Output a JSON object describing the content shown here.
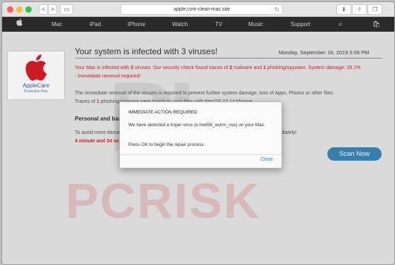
{
  "browser": {
    "url": "apple.com-clean-mac.site",
    "back": "<",
    "forward": ">",
    "reload": "↻"
  },
  "nav": {
    "items": [
      "Mac",
      "iPad",
      "iPhone",
      "Watch",
      "TV",
      "Music",
      "Support"
    ]
  },
  "watermark": {
    "big": "PL",
    "red": "PCRISK"
  },
  "applecare": {
    "title": "AppleCare",
    "subtitle": "Protection Plan"
  },
  "page": {
    "heading": "Your system is infected with 3 viruses!",
    "date": "Monday, September 16, 2019 5:06 PM",
    "alert": {
      "a": "Your Mac is infected with ",
      "n1": "3",
      "b": " viruses. Our security check found traces of ",
      "n2": "2",
      "c": " malware and ",
      "n3": "1",
      "d": " phishing/spyware. System damage: 28.1%",
      "e": "- Immediate removal required!"
    },
    "para1": "The immediate removal of the viruses is required to prevent further system damage, loss of Apps, Photos or other files.",
    "para2_a": "Traces of ",
    "para2_n": "1",
    "para2_b": " phishing/spyware were found on your Mac with MacOS 10.14 Mojave.",
    "personal": "Personal and banking information is at risk.",
    "para3": "To avoid more damage click on 'Scan Now' immediately. Our deep scan will provide help immediately!",
    "timer": "4 minute and 34 seconds remaining before damage is permanent.",
    "scan_button": "Scan Now"
  },
  "dialog": {
    "title": "IMMEDIATE ACTION REQUIRED",
    "message": "We have detected a trojan virus (e.tre456_worm_osx) on your Mac.",
    "instruction": "Press OK to begin the repair process.",
    "button": "Close"
  },
  "colors": {
    "alert_red": "#d22222",
    "scan_blue": "#3a86b9",
    "link_blue": "#2a79c9"
  }
}
